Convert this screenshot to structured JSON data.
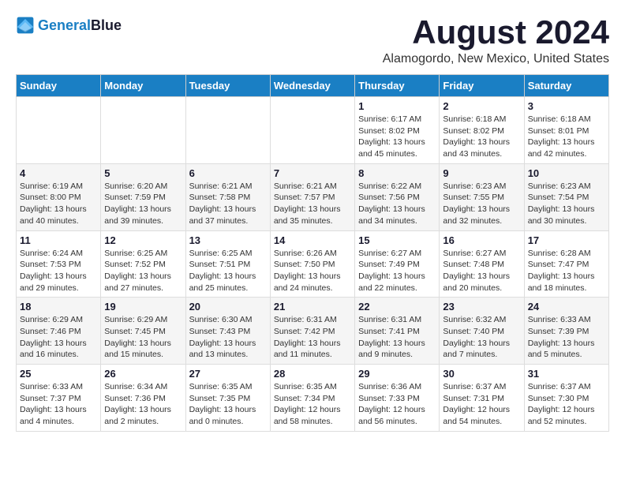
{
  "header": {
    "logo_line1": "General",
    "logo_line2": "Blue",
    "main_title": "August 2024",
    "subtitle": "Alamogordo, New Mexico, United States"
  },
  "calendar": {
    "days_of_week": [
      "Sunday",
      "Monday",
      "Tuesday",
      "Wednesday",
      "Thursday",
      "Friday",
      "Saturday"
    ],
    "weeks": [
      [
        {
          "day": "",
          "info": ""
        },
        {
          "day": "",
          "info": ""
        },
        {
          "day": "",
          "info": ""
        },
        {
          "day": "",
          "info": ""
        },
        {
          "day": "1",
          "info": "Sunrise: 6:17 AM\nSunset: 8:02 PM\nDaylight: 13 hours\nand 45 minutes."
        },
        {
          "day": "2",
          "info": "Sunrise: 6:18 AM\nSunset: 8:02 PM\nDaylight: 13 hours\nand 43 minutes."
        },
        {
          "day": "3",
          "info": "Sunrise: 6:18 AM\nSunset: 8:01 PM\nDaylight: 13 hours\nand 42 minutes."
        }
      ],
      [
        {
          "day": "4",
          "info": "Sunrise: 6:19 AM\nSunset: 8:00 PM\nDaylight: 13 hours\nand 40 minutes."
        },
        {
          "day": "5",
          "info": "Sunrise: 6:20 AM\nSunset: 7:59 PM\nDaylight: 13 hours\nand 39 minutes."
        },
        {
          "day": "6",
          "info": "Sunrise: 6:21 AM\nSunset: 7:58 PM\nDaylight: 13 hours\nand 37 minutes."
        },
        {
          "day": "7",
          "info": "Sunrise: 6:21 AM\nSunset: 7:57 PM\nDaylight: 13 hours\nand 35 minutes."
        },
        {
          "day": "8",
          "info": "Sunrise: 6:22 AM\nSunset: 7:56 PM\nDaylight: 13 hours\nand 34 minutes."
        },
        {
          "day": "9",
          "info": "Sunrise: 6:23 AM\nSunset: 7:55 PM\nDaylight: 13 hours\nand 32 minutes."
        },
        {
          "day": "10",
          "info": "Sunrise: 6:23 AM\nSunset: 7:54 PM\nDaylight: 13 hours\nand 30 minutes."
        }
      ],
      [
        {
          "day": "11",
          "info": "Sunrise: 6:24 AM\nSunset: 7:53 PM\nDaylight: 13 hours\nand 29 minutes."
        },
        {
          "day": "12",
          "info": "Sunrise: 6:25 AM\nSunset: 7:52 PM\nDaylight: 13 hours\nand 27 minutes."
        },
        {
          "day": "13",
          "info": "Sunrise: 6:25 AM\nSunset: 7:51 PM\nDaylight: 13 hours\nand 25 minutes."
        },
        {
          "day": "14",
          "info": "Sunrise: 6:26 AM\nSunset: 7:50 PM\nDaylight: 13 hours\nand 24 minutes."
        },
        {
          "day": "15",
          "info": "Sunrise: 6:27 AM\nSunset: 7:49 PM\nDaylight: 13 hours\nand 22 minutes."
        },
        {
          "day": "16",
          "info": "Sunrise: 6:27 AM\nSunset: 7:48 PM\nDaylight: 13 hours\nand 20 minutes."
        },
        {
          "day": "17",
          "info": "Sunrise: 6:28 AM\nSunset: 7:47 PM\nDaylight: 13 hours\nand 18 minutes."
        }
      ],
      [
        {
          "day": "18",
          "info": "Sunrise: 6:29 AM\nSunset: 7:46 PM\nDaylight: 13 hours\nand 16 minutes."
        },
        {
          "day": "19",
          "info": "Sunrise: 6:29 AM\nSunset: 7:45 PM\nDaylight: 13 hours\nand 15 minutes."
        },
        {
          "day": "20",
          "info": "Sunrise: 6:30 AM\nSunset: 7:43 PM\nDaylight: 13 hours\nand 13 minutes."
        },
        {
          "day": "21",
          "info": "Sunrise: 6:31 AM\nSunset: 7:42 PM\nDaylight: 13 hours\nand 11 minutes."
        },
        {
          "day": "22",
          "info": "Sunrise: 6:31 AM\nSunset: 7:41 PM\nDaylight: 13 hours\nand 9 minutes."
        },
        {
          "day": "23",
          "info": "Sunrise: 6:32 AM\nSunset: 7:40 PM\nDaylight: 13 hours\nand 7 minutes."
        },
        {
          "day": "24",
          "info": "Sunrise: 6:33 AM\nSunset: 7:39 PM\nDaylight: 13 hours\nand 5 minutes."
        }
      ],
      [
        {
          "day": "25",
          "info": "Sunrise: 6:33 AM\nSunset: 7:37 PM\nDaylight: 13 hours\nand 4 minutes."
        },
        {
          "day": "26",
          "info": "Sunrise: 6:34 AM\nSunset: 7:36 PM\nDaylight: 13 hours\nand 2 minutes."
        },
        {
          "day": "27",
          "info": "Sunrise: 6:35 AM\nSunset: 7:35 PM\nDaylight: 13 hours\nand 0 minutes."
        },
        {
          "day": "28",
          "info": "Sunrise: 6:35 AM\nSunset: 7:34 PM\nDaylight: 12 hours\nand 58 minutes."
        },
        {
          "day": "29",
          "info": "Sunrise: 6:36 AM\nSunset: 7:33 PM\nDaylight: 12 hours\nand 56 minutes."
        },
        {
          "day": "30",
          "info": "Sunrise: 6:37 AM\nSunset: 7:31 PM\nDaylight: 12 hours\nand 54 minutes."
        },
        {
          "day": "31",
          "info": "Sunrise: 6:37 AM\nSunset: 7:30 PM\nDaylight: 12 hours\nand 52 minutes."
        }
      ]
    ]
  }
}
